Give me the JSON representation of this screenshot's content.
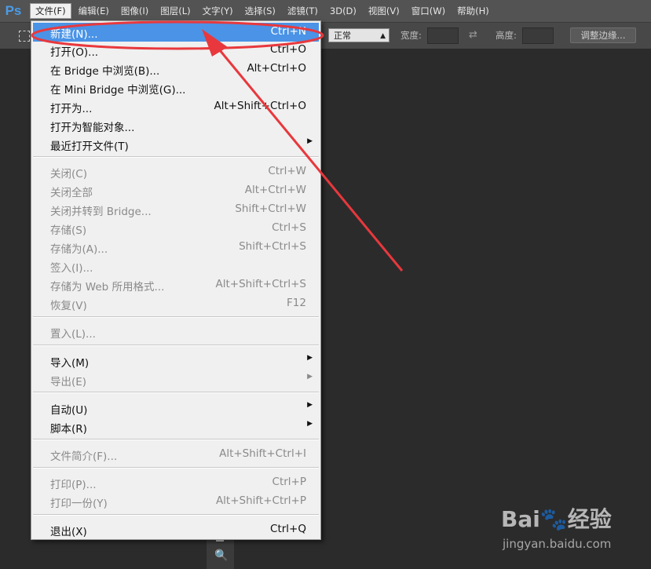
{
  "app": {
    "logo": "Ps"
  },
  "menubar": {
    "items": [
      {
        "label": "文件(F)"
      },
      {
        "label": "编辑(E)"
      },
      {
        "label": "图像(I)"
      },
      {
        "label": "图层(L)"
      },
      {
        "label": "文字(Y)"
      },
      {
        "label": "选择(S)"
      },
      {
        "label": "滤镜(T)"
      },
      {
        "label": "3D(D)"
      },
      {
        "label": "视图(V)"
      },
      {
        "label": "窗口(W)"
      },
      {
        "label": "帮助(H)"
      }
    ]
  },
  "options": {
    "style_value": "正常",
    "width_label": "宽度:",
    "height_label": "高度:",
    "refine_label": "调整边缘..."
  },
  "file_menu": {
    "items": [
      {
        "label": "新建(N)...",
        "shortcut": "Ctrl+N"
      },
      {
        "label": "打开(O)...",
        "shortcut": "Ctrl+O"
      },
      {
        "label": "在 Bridge 中浏览(B)...",
        "shortcut": "Alt+Ctrl+O"
      },
      {
        "label": "在 Mini Bridge 中浏览(G)...",
        "shortcut": ""
      },
      {
        "label": "打开为...",
        "shortcut": "Alt+Shift+Ctrl+O"
      },
      {
        "label": "打开为智能对象...",
        "shortcut": ""
      },
      {
        "label": "最近打开文件(T)",
        "shortcut": ""
      },
      {
        "label": "关闭(C)",
        "shortcut": "Ctrl+W"
      },
      {
        "label": "关闭全部",
        "shortcut": "Alt+Ctrl+W"
      },
      {
        "label": "关闭并转到 Bridge...",
        "shortcut": "Shift+Ctrl+W"
      },
      {
        "label": "存储(S)",
        "shortcut": "Ctrl+S"
      },
      {
        "label": "存储为(A)...",
        "shortcut": "Shift+Ctrl+S"
      },
      {
        "label": "签入(I)...",
        "shortcut": ""
      },
      {
        "label": "存储为 Web 所用格式...",
        "shortcut": "Alt+Shift+Ctrl+S"
      },
      {
        "label": "恢复(V)",
        "shortcut": "F12"
      },
      {
        "label": "置入(L)...",
        "shortcut": ""
      },
      {
        "label": "导入(M)",
        "shortcut": ""
      },
      {
        "label": "导出(E)",
        "shortcut": ""
      },
      {
        "label": "自动(U)",
        "shortcut": ""
      },
      {
        "label": "脚本(R)",
        "shortcut": ""
      },
      {
        "label": "文件简介(F)...",
        "shortcut": "Alt+Shift+Ctrl+I"
      },
      {
        "label": "打印(P)...",
        "shortcut": "Ctrl+P"
      },
      {
        "label": "打印一份(Y)",
        "shortcut": "Alt+Shift+Ctrl+P"
      },
      {
        "label": "退出(X)",
        "shortcut": "Ctrl+Q"
      }
    ]
  },
  "watermark": {
    "logo": "Bai🐾经验",
    "url": "jingyan.baidu.com"
  },
  "colors": {
    "highlight": "#4a93e6",
    "annotation": "#e8383d",
    "menubar": "#535353",
    "canvas": "#2b2b2b"
  }
}
